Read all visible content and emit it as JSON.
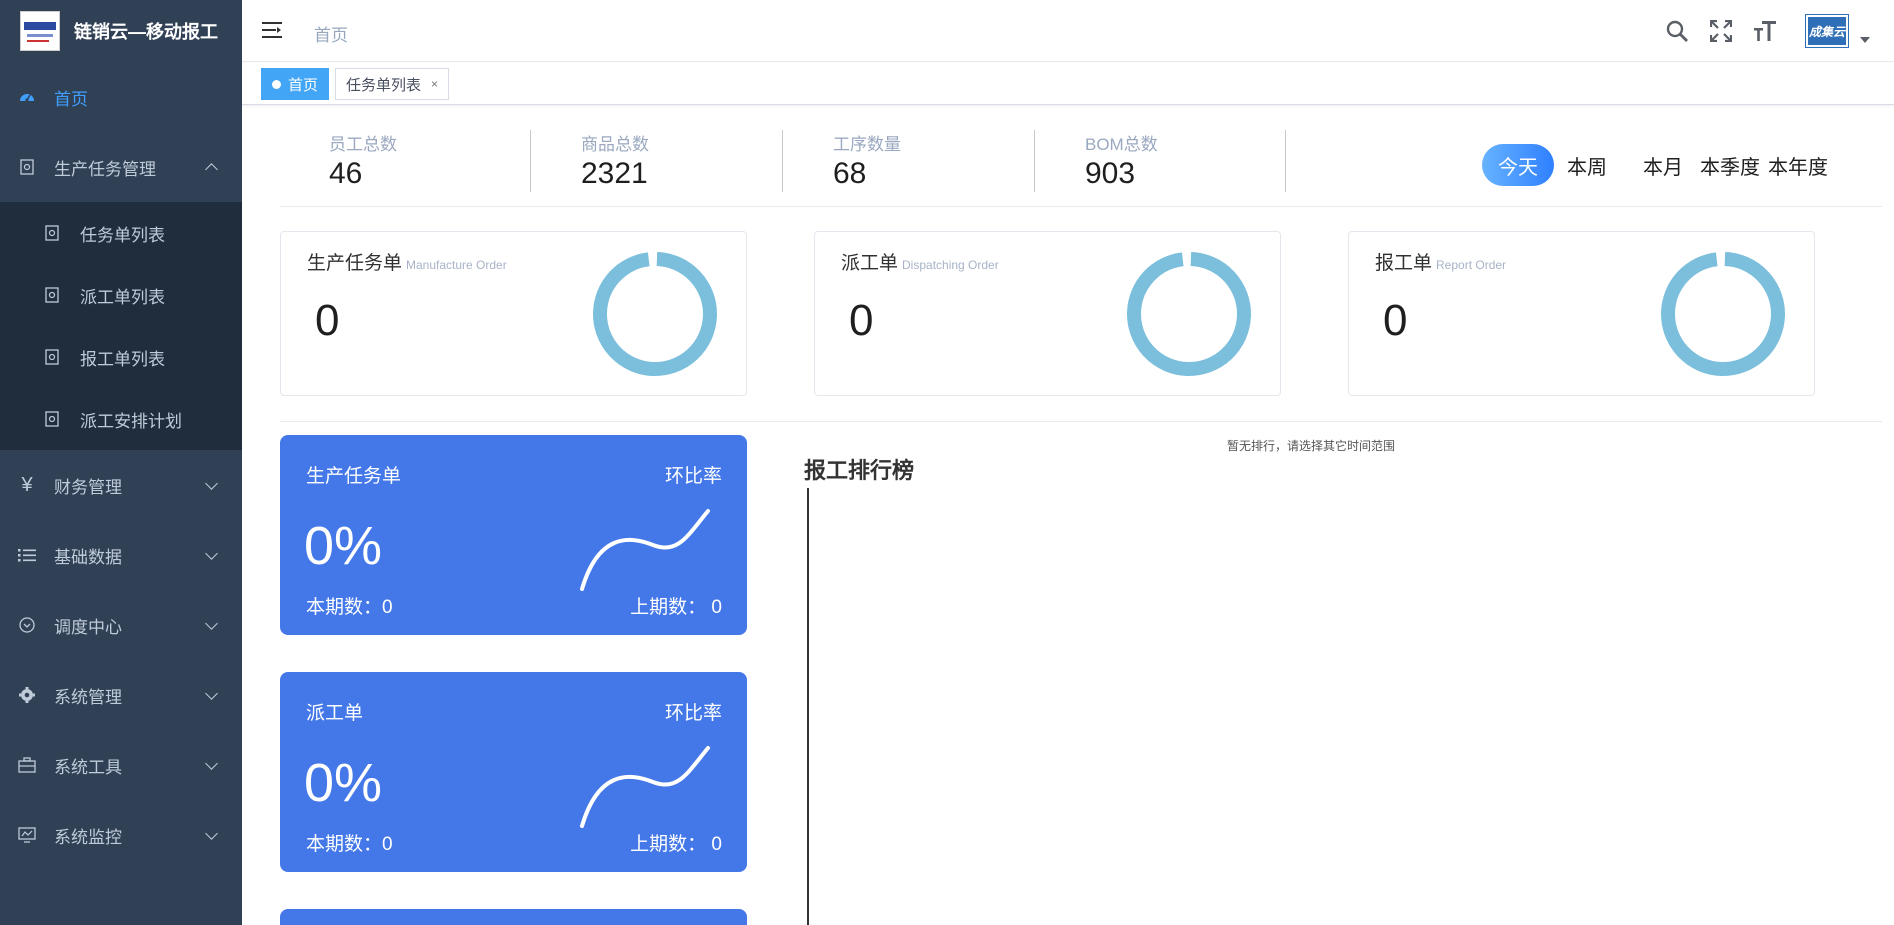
{
  "app": {
    "title": "链销云—移动报工"
  },
  "sidebar": {
    "items": [
      {
        "label": "首页",
        "icon": "dashboard-icon",
        "active": true
      },
      {
        "label": "生产任务管理",
        "icon": "task-icon",
        "expanded": true,
        "children": [
          {
            "label": "任务单列表",
            "icon": "doc-icon"
          },
          {
            "label": "派工单列表",
            "icon": "doc-icon"
          },
          {
            "label": "报工单列表",
            "icon": "doc-icon"
          },
          {
            "label": "派工安排计划",
            "icon": "doc-icon"
          }
        ]
      },
      {
        "label": "财务管理",
        "icon": "yen-icon"
      },
      {
        "label": "基础数据",
        "icon": "list-icon"
      },
      {
        "label": "调度中心",
        "icon": "circle-check-icon"
      },
      {
        "label": "系统管理",
        "icon": "gear-icon"
      },
      {
        "label": "系统工具",
        "icon": "toolbox-icon"
      },
      {
        "label": "系统监控",
        "icon": "monitor-icon"
      }
    ]
  },
  "header": {
    "breadcrumb": "首页",
    "avatar_text": "成集云"
  },
  "tags": [
    {
      "label": "首页",
      "active": true
    },
    {
      "label": "任务单列表",
      "active": false
    }
  ],
  "stats": [
    {
      "label": "员工总数",
      "value": "46"
    },
    {
      "label": "商品总数",
      "value": "2321"
    },
    {
      "label": "工序数量",
      "value": "68"
    },
    {
      "label": "BOM总数",
      "value": "903"
    }
  ],
  "time_range": {
    "options": [
      "今天",
      "本周",
      "本月",
      "本季度",
      "本年度"
    ],
    "selected": "今天"
  },
  "order_cards": [
    {
      "title": "生产任务单",
      "subtitle": "Manufacture Order",
      "count": "0"
    },
    {
      "title": "派工单",
      "subtitle": "Dispatching Order",
      "count": "0"
    },
    {
      "title": "报工单",
      "subtitle": "Report Order",
      "count": "0"
    }
  ],
  "ratio_cards": [
    {
      "title": "生产任务单",
      "ratio_label": "环比率",
      "percent": "0%",
      "current": "本期数：0",
      "previous": "上期数： 0"
    },
    {
      "title": "派工单",
      "ratio_label": "环比率",
      "percent": "0%",
      "current": "本期数：0",
      "previous": "上期数： 0"
    }
  ],
  "ranking": {
    "title": "报工排行榜",
    "empty_text": "暂无排行，请选择其它时间范围"
  },
  "colors": {
    "sidebar_bg": "#304156",
    "accent": "#409eff",
    "card_blue": "#4478e8",
    "donut": "#7bbfdc"
  }
}
